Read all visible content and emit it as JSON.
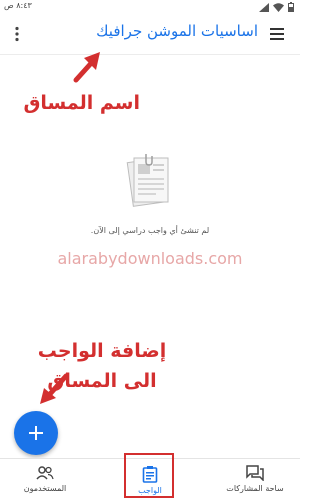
{
  "status_bar": {
    "time": "٨:٤٣ ص"
  },
  "app_bar": {
    "title": "اساسيات الموشن جرافيك"
  },
  "annotations": {
    "course_name": "اسم المساق",
    "add_assignment_line1": "إضافة الواجب",
    "add_assignment_line2": "الى المساق"
  },
  "empty_state": {
    "message": "لم تنشئ أي واجب دراسي إلى الآن.",
    "illustration_icon": "document-stack-icon"
  },
  "watermark": {
    "text": "alarabydownloads.com"
  },
  "fab": {
    "icon": "plus-icon"
  },
  "bottom_nav": {
    "items": [
      {
        "label": "ساحة المشاركات",
        "icon": "forum-icon",
        "active": false
      },
      {
        "label": "الواجب",
        "icon": "assignment-icon",
        "active": true
      },
      {
        "label": "المستخدمون",
        "icon": "people-icon",
        "active": false
      }
    ]
  },
  "colors": {
    "accent": "#1a73e8",
    "annotation": "#d32f2f",
    "watermark": "#e7a7a7"
  }
}
